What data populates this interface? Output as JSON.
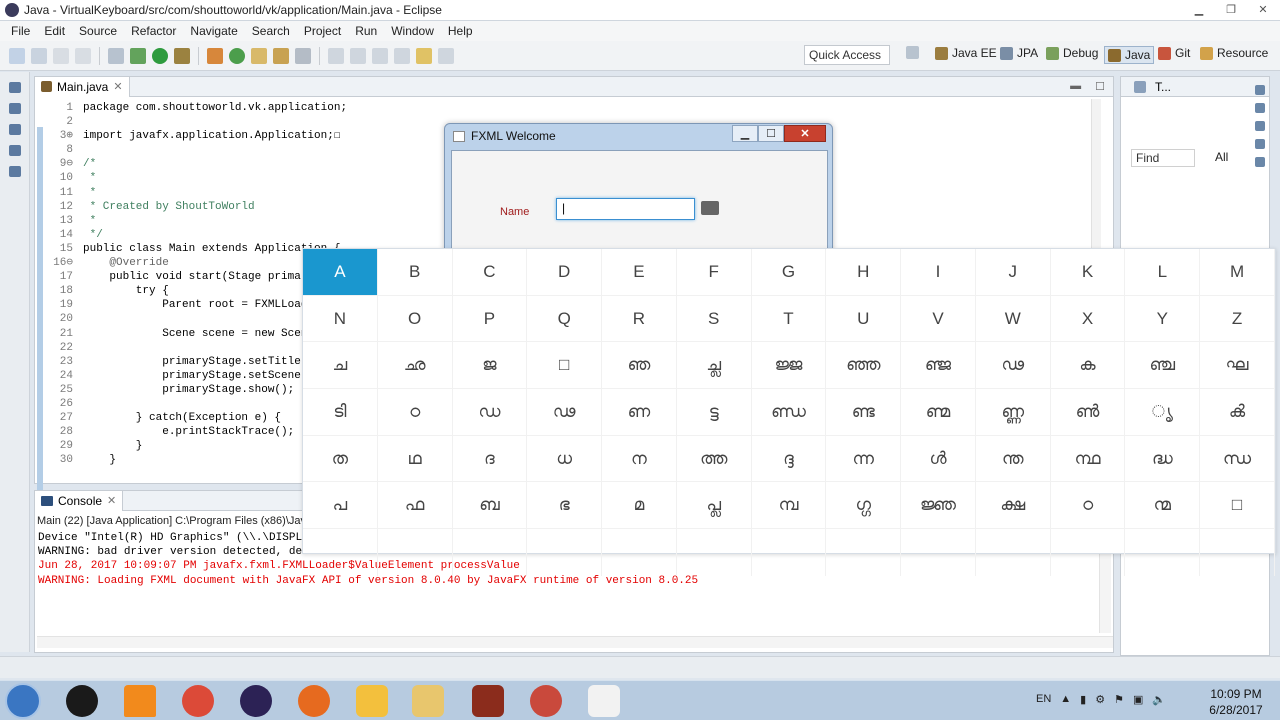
{
  "window": {
    "title": "Java - VirtualKeyboard/src/com/shouttoworld/vk/application/Main.java - Eclipse"
  },
  "menu": [
    "File",
    "Edit",
    "Source",
    "Refactor",
    "Navigate",
    "Search",
    "Project",
    "Run",
    "Window",
    "Help"
  ],
  "toolbar": {
    "quick_access": "Quick Access",
    "perspectives": [
      "Java EE",
      "JPA",
      "Debug",
      "Java",
      "Git",
      "Resource"
    ]
  },
  "editor": {
    "tab_label": "Main.java",
    "lines": [
      {
        "n": "1",
        "t": "package com.shouttoworld.vk.application;"
      },
      {
        "n": "2",
        "t": ""
      },
      {
        "n": "3⊕",
        "t": "import javafx.application.Application;☐"
      },
      {
        "n": "8",
        "t": ""
      },
      {
        "n": "9⊖",
        "t": "/*"
      },
      {
        "n": "10",
        "t": " *"
      },
      {
        "n": "11",
        "t": " *"
      },
      {
        "n": "12",
        "t": " * Created by ShoutToWorld"
      },
      {
        "n": "13",
        "t": " *"
      },
      {
        "n": "14",
        "t": " */"
      },
      {
        "n": "15",
        "t": "public class Main extends Application {"
      },
      {
        "n": "16⊖",
        "t": "    @Override"
      },
      {
        "n": "17",
        "t": "    public void start(Stage primary"
      },
      {
        "n": "18",
        "t": "        try {"
      },
      {
        "n": "19",
        "t": "            Parent root = FXMLLoade"
      },
      {
        "n": "20",
        "t": ""
      },
      {
        "n": "21",
        "t": "            Scene scene = new Scene"
      },
      {
        "n": "22",
        "t": ""
      },
      {
        "n": "23",
        "t": "            primaryStage.setTitle(\""
      },
      {
        "n": "24",
        "t": "            primaryStage.setScene(s"
      },
      {
        "n": "25",
        "t": "            primaryStage.show();"
      },
      {
        "n": "26",
        "t": ""
      },
      {
        "n": "27",
        "t": "        } catch(Exception e) {"
      },
      {
        "n": "28",
        "t": "            e.printStackTrace();"
      },
      {
        "n": "29",
        "t": "        }"
      },
      {
        "n": "30",
        "t": "    }"
      }
    ]
  },
  "outline": {
    "tab_label": "T...",
    "find_placeholder": "Find",
    "all_label": "All"
  },
  "console": {
    "tab_label": "Console",
    "description": "Main (22) [Java Application] C:\\Program Files (x86)\\Jav",
    "lines": [
      {
        "text": "Device \"Intel(R) HD Graphics\" (\\\\.\\DISPL",
        "err": false
      },
      {
        "text": "WARNING: bad driver version detected, de",
        "err": false
      },
      {
        "text": "Jun 28, 2017 10:09:07 PM javafx.fxml.FXMLLoader$ValueElement processValue",
        "err": true
      },
      {
        "text": "WARNING: Loading FXML document with JavaFX API of version 8.0.40 by JavaFX runtime of version 8.0.25",
        "err": true
      }
    ]
  },
  "fxml_window": {
    "title": "FXML Welcome",
    "name_label": "Name",
    "name_value": "|"
  },
  "keyboard": {
    "active_key": "A",
    "rows": [
      [
        "A",
        "B",
        "C",
        "D",
        "E",
        "F",
        "G",
        "H",
        "I",
        "J",
        "K",
        "L",
        "M"
      ],
      [
        "N",
        "O",
        "P",
        "Q",
        "R",
        "S",
        "T",
        "U",
        "V",
        "W",
        "X",
        "Y",
        "Z"
      ],
      [
        "ച",
        "ഛ",
        "ജ",
        "□",
        "ഞ",
        "ച്ല",
        "ജ്ജ",
        "ഞ്ഞ",
        "ഞ്ജ",
        "ഢ",
        "ക",
        "ഞ്ച",
        "ഘ"
      ],
      [
        "ടി",
        "ഠ",
        "ഡ",
        "ഢ",
        "ണ",
        "ട്ട",
        "ണ്ഡ",
        "ണ്ട",
        "ണ്മ",
        "ണ്ണ",
        "ൺ",
        "ൃ",
        "ൿ"
      ],
      [
        "ത",
        "ഥ",
        "ദ",
        "ധ",
        "ന",
        "ത്ത",
        "ദ്ദ",
        "ന്ന",
        "ൾ",
        "ന്ത",
        "ന്ഥ",
        "ദ്ധ",
        "ന്ധ"
      ],
      [
        "പ",
        "ഫ",
        "ബ",
        "ഭ",
        "മ",
        "പ്ല",
        "മ്പ",
        "ഗ്ഗ",
        "ജ്ഞ",
        "ക്ഷ",
        "ഠ",
        "ന്മ",
        "□"
      ],
      [
        "",
        "",
        "",
        "",
        "",
        "",
        "",
        "",
        "",
        "",
        "",
        "",
        ""
      ]
    ]
  },
  "taskbar": {
    "lang": "EN",
    "time": "10:09 PM",
    "date": "6/28/2017"
  }
}
